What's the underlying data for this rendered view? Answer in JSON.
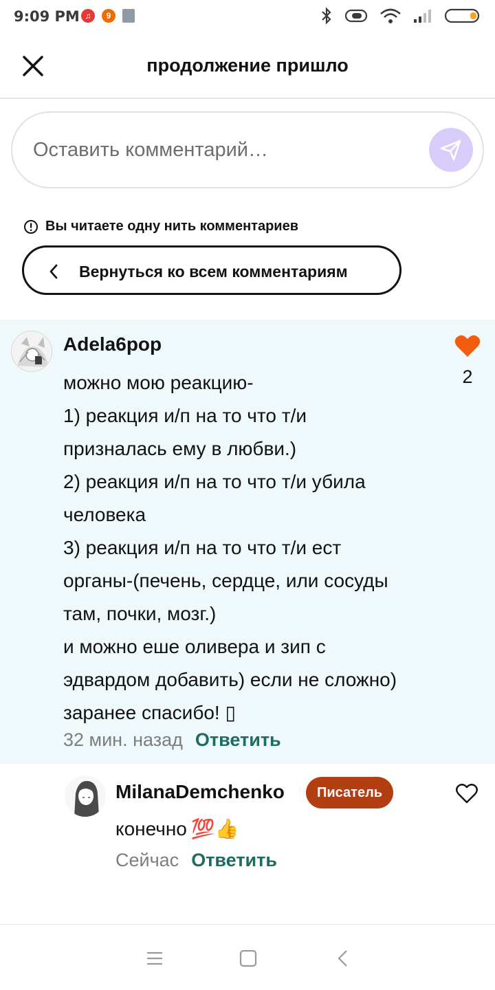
{
  "status_bar": {
    "time": "9:09 PM",
    "icons": [
      "music-app-icon",
      "notification-app-icon",
      "document-icon",
      "bluetooth-icon",
      "vibrate-icon",
      "wifi-icon",
      "signal-icon",
      "battery-icon"
    ]
  },
  "header": {
    "title": "продолжение пришло",
    "close_icon": "close-icon"
  },
  "comment_input": {
    "placeholder": "Оставить комментарий…",
    "send_icon": "send-icon"
  },
  "thread": {
    "notice": "Вы читаете одну нить комментариев",
    "back_label": "Вернуться ко всем комментариям"
  },
  "main_comment": {
    "author": "Adela6pop",
    "lines": [
      "можно мою реакцию-",
      "1) реакция и/п на то что т/и",
      "призналась ему в любви.)",
      "2) реакция и/п на то что т/и убила",
      "человека",
      "3) реакция и/п на то что т/и ест",
      "органы-(печень, сердце, или сосуды",
      "там, почки, мозг.)",
      "и можно еше оливера и зип с",
      "эдвардом добавить) если не сложно)",
      "заранее спасибо! ▯"
    ],
    "time": "32 мин. назад",
    "reply": "Ответить",
    "likes": "2",
    "liked": true
  },
  "reply_comment": {
    "author": "MilanaDemchenko",
    "badge": "Писатель",
    "text": "конечно",
    "emojis": "💯👍",
    "time": "Сейчас",
    "reply": "Ответить",
    "liked": false
  },
  "colors": {
    "accent_green": "#1e6b60",
    "badge_bg": "#b33e12",
    "like_orange": "#f25c0e",
    "send_bg": "#d8ccfb",
    "thread_bg": "#eff9fc"
  }
}
